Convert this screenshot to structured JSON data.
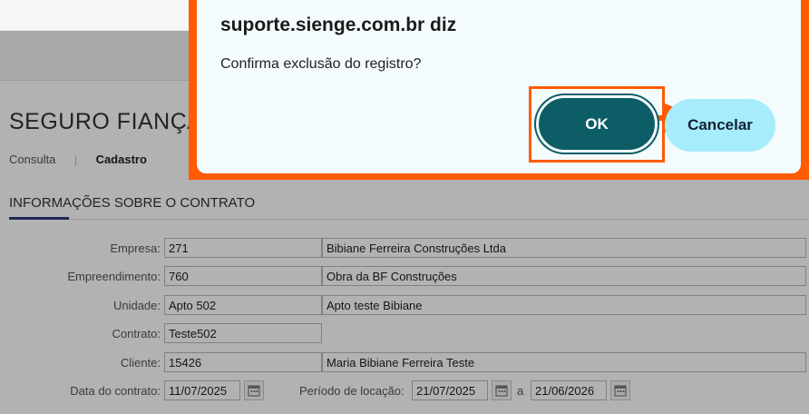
{
  "page": {
    "title": "SEGURO FIANÇA",
    "tabs": [
      {
        "label": "Consulta"
      },
      {
        "label": "Cadastro"
      }
    ],
    "section_title": "INFORMAÇÕES SOBRE O CONTRATO",
    "fields": {
      "empresa": {
        "label": "Empresa:",
        "code": "271",
        "name": "Bibiane Ferreira Construções Ltda"
      },
      "empreendimento": {
        "label": "Empreendimento:",
        "code": "760",
        "name": "Obra da BF Construções"
      },
      "unidade": {
        "label": "Unidade:",
        "code": "Apto 502",
        "name": "Apto teste Bibiane"
      },
      "contrato": {
        "label": "Contrato:",
        "code": "Teste502"
      },
      "cliente": {
        "label": "Cliente:",
        "code": "15426",
        "name": "Maria Bibiane Ferreira Teste"
      },
      "data_contrato": {
        "label": "Data do contrato:",
        "value": "11/07/2025"
      },
      "periodo": {
        "label": "Período de locação:",
        "start": "21/07/2025",
        "separator": "a",
        "end": "21/06/2026"
      }
    }
  },
  "dialog": {
    "title": "suporte.sienge.com.br diz",
    "message": "Confirma exclusão do registro?",
    "ok_label": "OK",
    "cancel_label": "Cancelar"
  },
  "colors": {
    "highlight": "#ff5b00",
    "ok_button": "#0c5d66",
    "cancel_button": "#a6ecfb",
    "accent_underline": "#2b3a80"
  },
  "icons": {
    "calendar": "calendar-icon",
    "arrow": "arrow-right-icon"
  }
}
